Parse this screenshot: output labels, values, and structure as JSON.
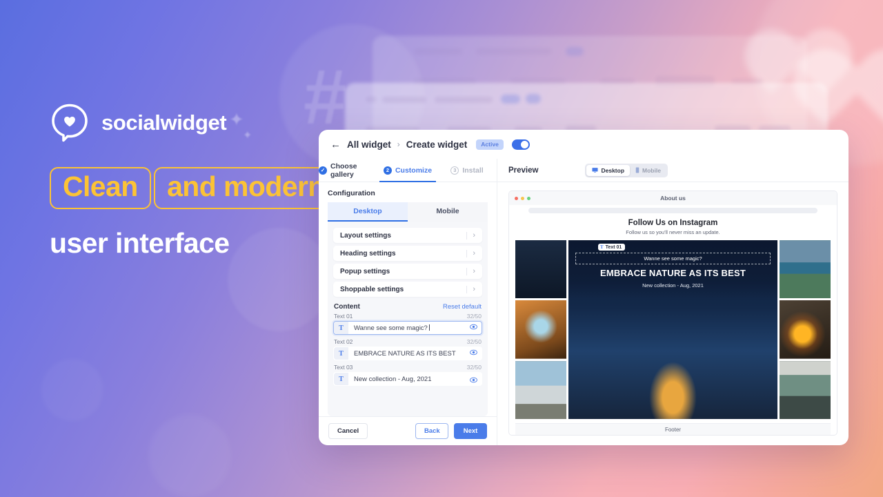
{
  "brand": {
    "name": "socialwidget",
    "logo_icon": "speech-bubble-heart-icon"
  },
  "marketing": {
    "line1": "Clean",
    "line2": "and modern",
    "line3": "user interface",
    "accent_color": "#fcc335",
    "text_color": "#ffffff"
  },
  "app": {
    "header": {
      "back_icon": "back-arrow-icon",
      "breadcrumb_parent": "All widget",
      "breadcrumb_sep": "›",
      "breadcrumb_current": "Create widget",
      "status_badge": "Active",
      "toggle_state": "on",
      "toggle_color": "#3b6fe8"
    },
    "steps": [
      {
        "num": "✓",
        "label": "Choose gallery",
        "state": "done"
      },
      {
        "num": "2",
        "label": "Customize",
        "state": "active"
      },
      {
        "num": "3",
        "label": "Install",
        "state": "todo"
      }
    ],
    "configuration": {
      "title": "Configuration",
      "device_tabs": [
        {
          "label": "Desktop",
          "selected": true
        },
        {
          "label": "Mobile",
          "selected": false
        }
      ],
      "settings_rows": [
        {
          "label": "Layout settings",
          "chevron": "chevron-right-icon"
        },
        {
          "label": "Heading settings",
          "chevron": "chevron-right-icon"
        },
        {
          "label": "Popup settings",
          "chevron": "chevron-right-icon"
        },
        {
          "label": "Shoppable settings",
          "chevron": "chevron-right-icon"
        }
      ],
      "content": {
        "title": "Content",
        "reset_label": "Reset default",
        "fields": [
          {
            "name": "Text 01",
            "counter": "32/50",
            "value": "Wanne see some magic?",
            "focused": true,
            "icon": "text-icon",
            "eye": "eye-icon"
          },
          {
            "name": "Text 02",
            "counter": "32/50",
            "value": "EMBRACE NATURE AS ITS BEST",
            "focused": false,
            "icon": "text-icon",
            "eye": "eye-icon"
          },
          {
            "name": "Text 03",
            "counter": "32/50",
            "value": "New collection - Aug, 2021",
            "focused": false,
            "icon": "text-icon",
            "eye": "eye-icon"
          }
        ]
      }
    },
    "footer": {
      "cancel_label": "Cancel",
      "back_label": "Back",
      "next_label": "Next",
      "next_color": "#4a7ce9"
    },
    "preview": {
      "title": "Preview",
      "view_modes": [
        {
          "label": "Desktop",
          "icon": "monitor-icon",
          "selected": true
        },
        {
          "label": "Mobile",
          "icon": "phone-icon",
          "selected": false
        }
      ],
      "browser": {
        "dot_colors": [
          "#f66f63",
          "#f7c550",
          "#69d27f"
        ],
        "page_title": "About us",
        "heading": "Follow Us on Instagram",
        "subheading": "Follow us so you'll never miss an update.",
        "footer_label": "Footer",
        "overlay": {
          "selection_badge": "Text 01",
          "selection_badge_icon": "text-icon",
          "text_01": "Wanne see some magic?",
          "text_02": "EMBRACE NATURE AS ITS BEST",
          "text_03": "New collection - Aug, 2021"
        },
        "gallery": {
          "left_column": [
            "rooftop-tent-night-photo",
            "tent-interior-forest-photo",
            "caravan-lakeside-photo"
          ],
          "center": "tent-under-starry-sky-photo",
          "right_column": [
            "blue-tent-mountain-photo",
            "campfire-photo",
            "man-in-tent-photo"
          ]
        }
      }
    }
  }
}
